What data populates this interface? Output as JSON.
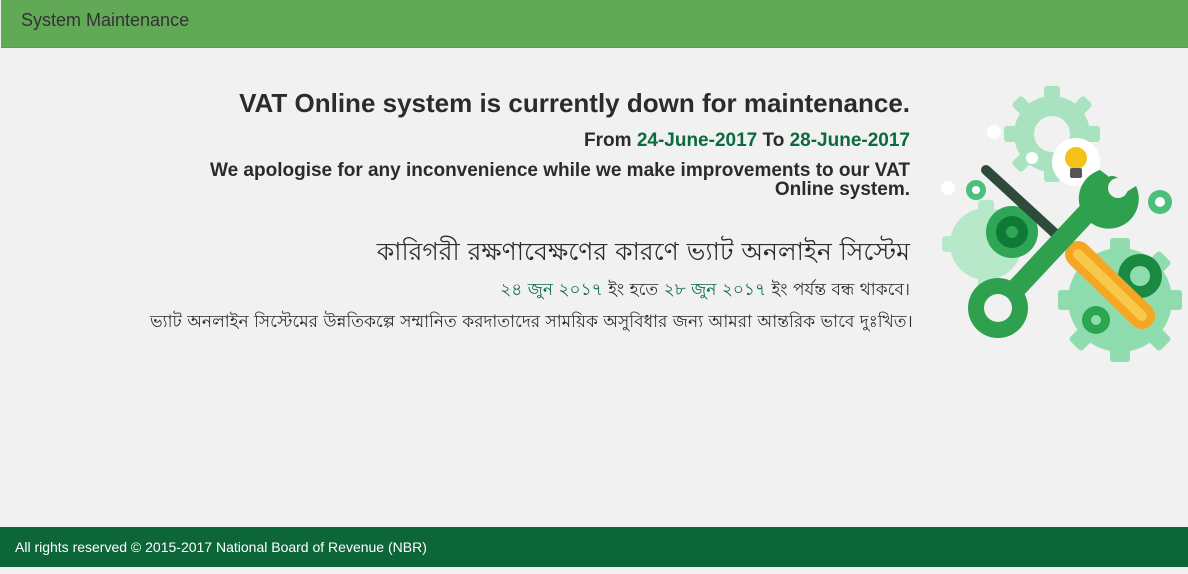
{
  "header": {
    "title": "System Maintenance"
  },
  "notice": {
    "headline": "VAT Online system is currently down for maintenance.",
    "from_label": "From",
    "from_date": "24-June-2017",
    "to_label": "To",
    "to_date": "28-June-2017",
    "apology": "We apologise for any inconvenience while we make improvements to our VAT Online system."
  },
  "notice_bn": {
    "headline": "কারিগরী রক্ষণাবেক্ষণের কারণে ভ্যাট অনলাইন সিস্টেম",
    "from_date": "২৪ জুন ২০১৭",
    "from_suffix": "ইং হতে",
    "to_date": "২৮ জুন ২০১৭",
    "to_suffix": "ইং পর্যন্ত বন্ধ থাকবে।",
    "apology": "ভ্যাট অনলাইন সিস্টেমের উন্নতিকল্পে সম্মানিত করদাতাদের সাময়িক অসুবিধার জন্য আমরা আন্তরিক ভাবে দুঃখিত।"
  },
  "footer": {
    "copyright": "All rights reserved © 2015-2017 National Board of Revenue (NBR)"
  },
  "colors": {
    "header_bg": "#61a857",
    "footer_bg": "#0c6638",
    "accent_date": "#0b6a3e",
    "page_bg": "#f1f1f1"
  },
  "icons": [
    "maintenance-tools-illustration",
    "wrench-icon",
    "screwdriver-icon",
    "gear-icon",
    "lightbulb-icon"
  ]
}
